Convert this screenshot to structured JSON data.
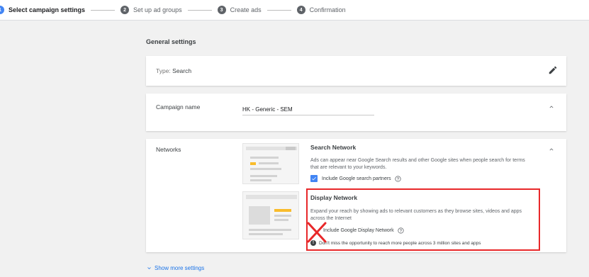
{
  "stepper": {
    "steps": [
      {
        "num": "1",
        "label": "Select campaign settings"
      },
      {
        "num": "2",
        "label": "Set up ad groups"
      },
      {
        "num": "3",
        "label": "Create ads"
      },
      {
        "num": "4",
        "label": "Confirmation"
      }
    ]
  },
  "general": {
    "title": "General settings",
    "type_label": "Type: ",
    "type_value": "Search"
  },
  "campaign": {
    "label": "Campaign name",
    "value": "HK - Generic - SEM"
  },
  "networks": {
    "label": "Networks",
    "search": {
      "title": "Search Network",
      "description": "Ads can appear near Google Search results and other Google sites when people search for terms that are relevant to your keywords.",
      "checkbox_label": "Include Google search partners",
      "checked": true
    },
    "display": {
      "title": "Display Network",
      "description": "Expand your reach by showing ads to relevant customers as they browse sites, videos and apps across the Internet",
      "checkbox_label": "Include Google Display Network",
      "checked": false,
      "warning": "Don't miss the opportunity to reach more people across 3 million sites and apps"
    }
  },
  "footer": {
    "more_label": "Show more settings"
  },
  "colors": {
    "accent": "#4285f4",
    "link": "#1a73e8",
    "annotation": "#e8282a"
  }
}
